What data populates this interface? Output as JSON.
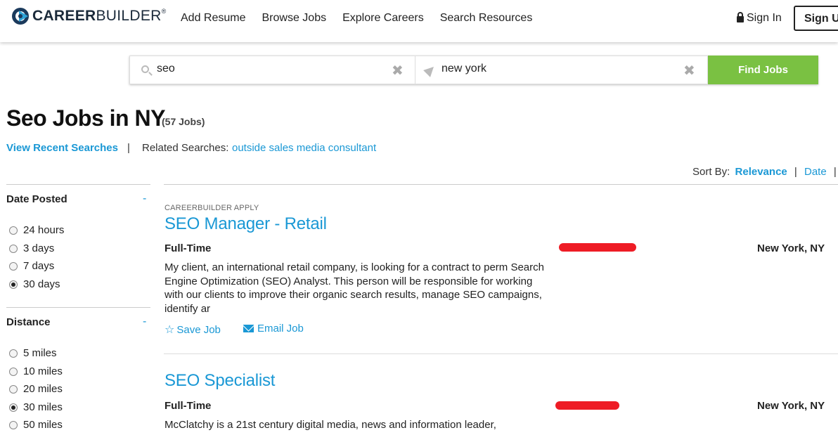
{
  "header": {
    "logo_career": "CAREER",
    "logo_builder": "BUILDER",
    "logo_tm": "®",
    "nav": [
      "Add Resume",
      "Browse Jobs",
      "Explore Careers",
      "Search Resources"
    ],
    "sign_in": "Sign In",
    "sign_up": "Sign Up"
  },
  "search": {
    "keyword_value": "seo",
    "location_value": "new york",
    "clear_glyph": "✖",
    "find_button": "Find Jobs"
  },
  "results_header": {
    "title": "Seo Jobs in NY",
    "count": "(57 Jobs)",
    "recent_searches": "View Recent Searches",
    "separator": "|",
    "related_label": "Related Searches:",
    "related_link": "outside sales media consultant",
    "sort_label": "Sort By:",
    "sort_relevance": "Relevance",
    "sort_date": "Date",
    "sort_sep": "|"
  },
  "filters": {
    "date_posted": {
      "heading": "Date Posted",
      "toggle": "-",
      "options": [
        "24 hours",
        "3 days",
        "7 days",
        "30 days"
      ],
      "selected_index": 3
    },
    "distance": {
      "heading": "Distance",
      "toggle": "-",
      "options": [
        "5 miles",
        "10 miles",
        "20 miles",
        "30 miles",
        "50 miles"
      ],
      "selected_index": 3
    }
  },
  "jobs": [
    {
      "tag": "CAREERBUILDER APPLY",
      "title": "SEO Manager - Retail",
      "type": "Full-Time",
      "location": "New York, NY",
      "description": "My client, an international retail company, is looking for a contract to perm Search Engine Optimization (SEO) Analyst. This person will be responsible for working with our clients to improve their organic search results, manage SEO campaigns, identify ar",
      "save_label": "Save Job",
      "email_label": "Email Job"
    },
    {
      "title": "SEO Specialist",
      "type": "Full-Time",
      "location": "New York, NY",
      "description": "McClatchy is a 21st century digital media, news and information leader,"
    }
  ],
  "colors": {
    "link_blue": "#1a98d5",
    "find_green": "#7ac142",
    "redaction_red": "#ee1c25"
  }
}
